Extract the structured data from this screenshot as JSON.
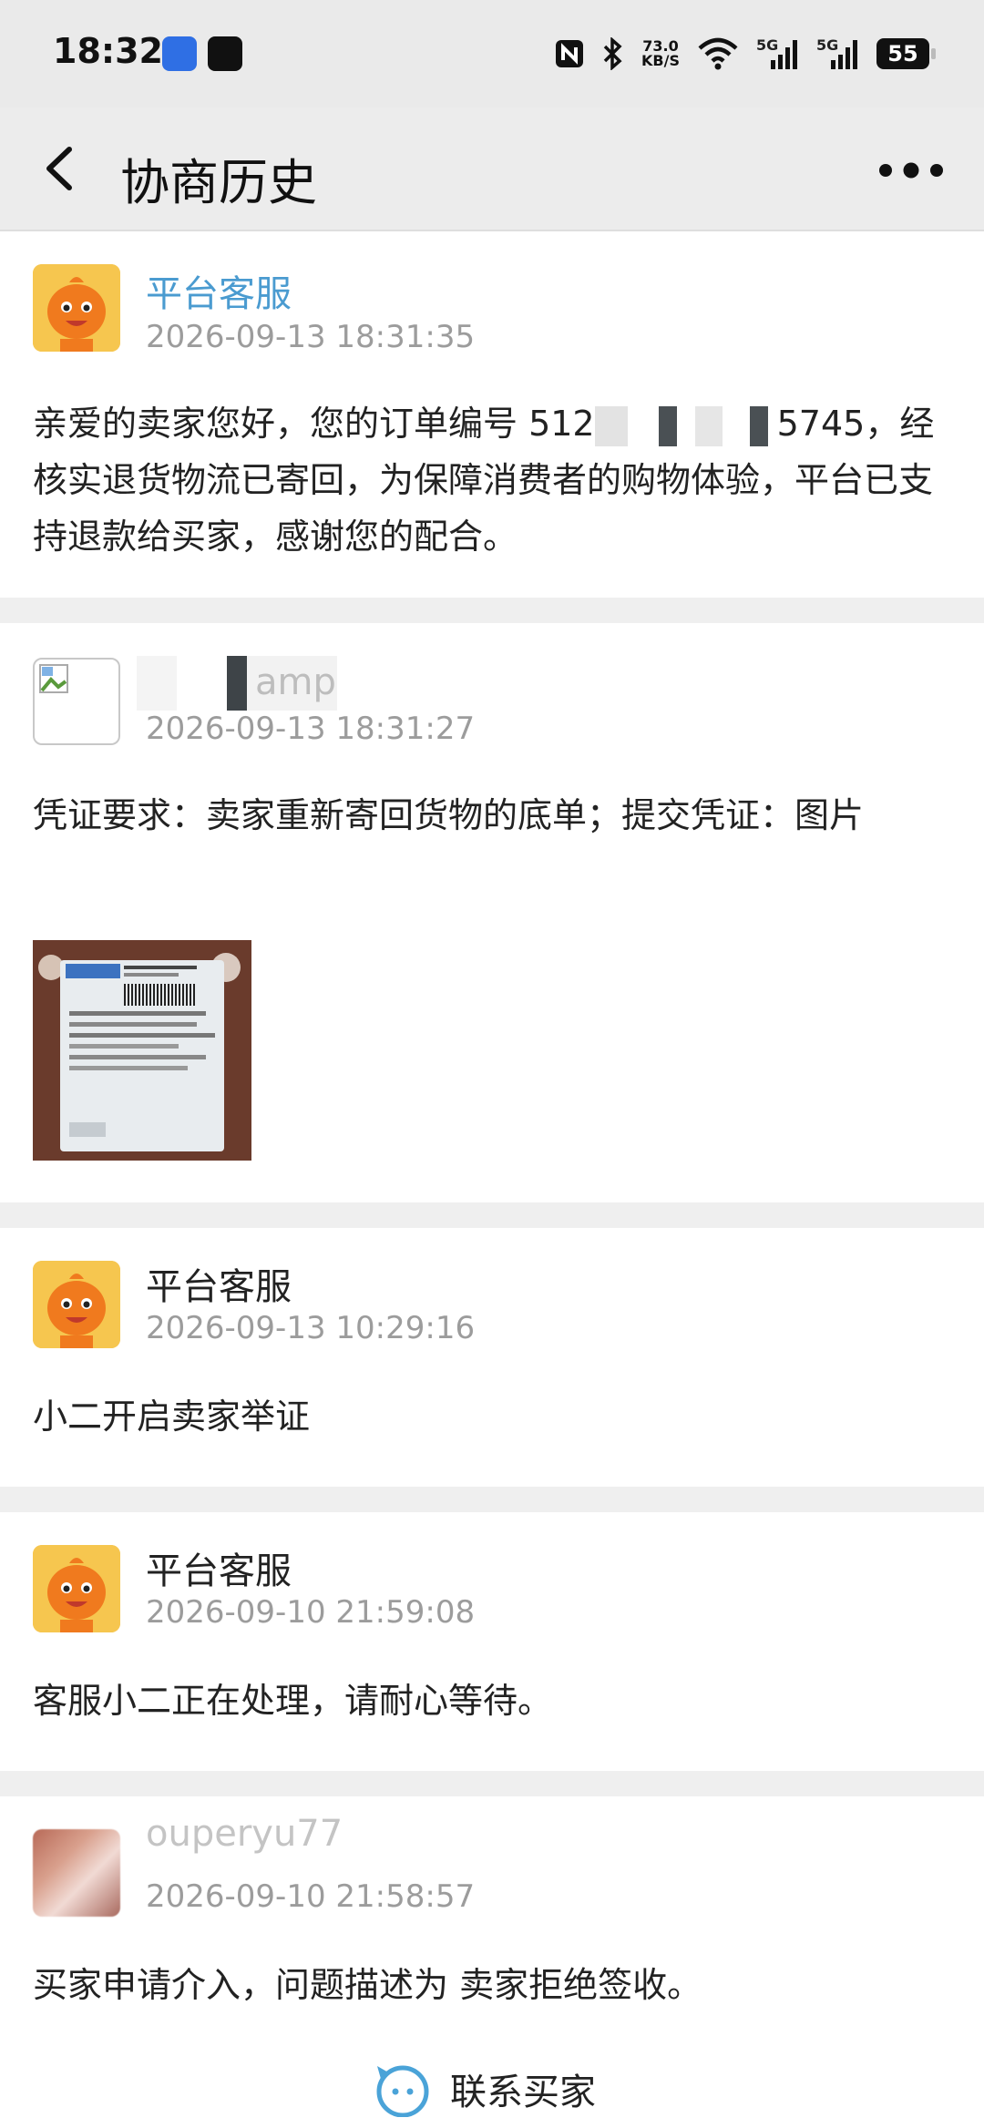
{
  "status_bar": {
    "time": "18:32",
    "net_speed_value": "73.0",
    "net_speed_unit": "KB/S",
    "network_1": "5G",
    "network_2": "5G",
    "battery": "55"
  },
  "nav": {
    "title": "协商历史"
  },
  "records": [
    {
      "name": "平台客服",
      "time": "2026-09-13 18:31:35",
      "message_part1": "亲爱的卖家您好，您的订单编号 512",
      "message_part2": "5745，经核实退货物流已寄回，为保障消费者的购物体验，平台已支持退款给买家，感谢您的配合。"
    },
    {
      "name": "amp",
      "time": "2026-09-13 18:31:27",
      "message": "凭证要求：卖家重新寄回货物的底单；提交凭证：图片"
    },
    {
      "name": "平台客服",
      "time": "2026-09-13 10:29:16",
      "message": "小二开启卖家举证"
    },
    {
      "name": "平台客服",
      "time": "2026-09-10 21:59:08",
      "message": "客服小二正在处理，请耐心等待。"
    },
    {
      "name": "ouperyu77",
      "time": "2026-09-10 21:58:57",
      "message": "买家申请介入，问题描述为  卖家拒绝签收。"
    }
  ],
  "footer": {
    "contact_buyer_label": "联系买家"
  },
  "colors": {
    "accent_blue": "#4a9bd0",
    "avatar_orange": "#f6c64f",
    "timestamp_gray": "#9c9c9c"
  }
}
